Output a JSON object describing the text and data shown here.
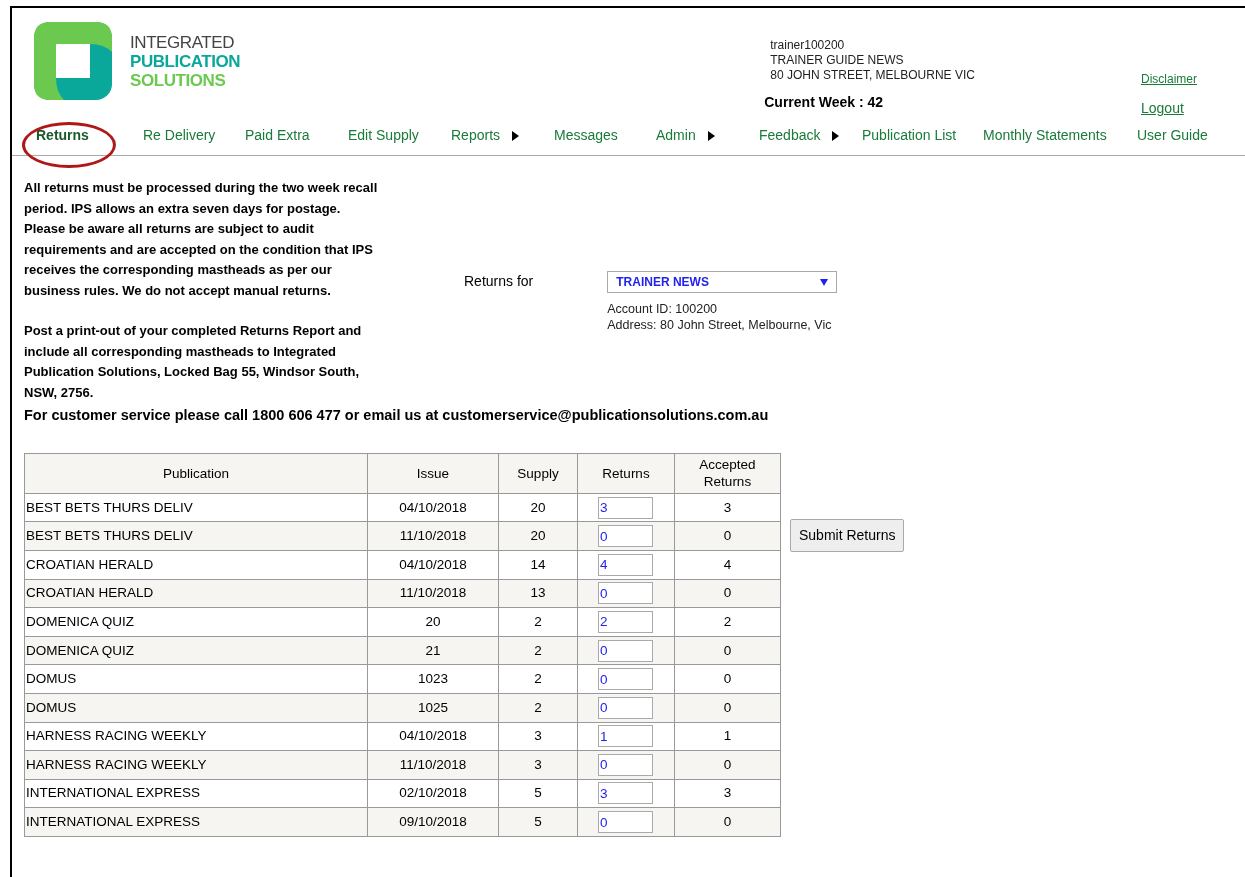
{
  "logo": {
    "lines": [
      "INTEGRATED",
      "PUBLICATION",
      "SOLUTIONS"
    ]
  },
  "account": {
    "username": "trainer100200",
    "name": "TRAINER GUIDE NEWS",
    "address": "80 JOHN STREET, MELBOURNE VIC",
    "current_week": "Current Week : 42"
  },
  "links": [
    "Disclaimer",
    "Logout"
  ],
  "nav": [
    {
      "label": "Returns",
      "selected": true,
      "circled": true,
      "has_submenu": false
    },
    {
      "label": "Re Delivery",
      "selected": false,
      "circled": false,
      "has_submenu": false
    },
    {
      "label": "Paid Extra",
      "selected": false,
      "circled": false,
      "has_submenu": false
    },
    {
      "label": "Edit Supply",
      "selected": false,
      "circled": false,
      "has_submenu": false
    },
    {
      "label": "Reports",
      "selected": false,
      "circled": false,
      "has_submenu": true
    },
    {
      "label": "Messages",
      "selected": false,
      "circled": false,
      "has_submenu": false
    },
    {
      "label": "Admin",
      "selected": false,
      "circled": false,
      "has_submenu": true
    },
    {
      "label": "Feedback",
      "selected": false,
      "circled": false,
      "has_submenu": true
    },
    {
      "label": "Publication List",
      "selected": false,
      "circled": false,
      "has_submenu": false
    },
    {
      "label": "Monthly Statements",
      "selected": false,
      "circled": false,
      "has_submenu": false
    },
    {
      "label": "User Guide",
      "selected": false,
      "circled": false,
      "has_submenu": false
    }
  ],
  "instructions": [
    "All returns must be processed during the two week recall period. IPS allows an extra seven days for postage. Please be aware all returns are subject to audit requirements and are accepted on the condition that IPS receives the corresponding mastheads as per our business rules. We do not accept manual returns.",
    "Post a print-out of your completed Returns Report and include all corresponding mastheads to Integrated Publication Solutions, Locked Bag 55, Windsor South, NSW, 2756."
  ],
  "returns_for": {
    "label": "Returns for",
    "value": "TRAINER NEWS",
    "account_id": "Account ID: 100200",
    "address": "Address: 80 John Street, Melbourne, Vic"
  },
  "customer_service": "For customer service please call 1800 606 477 or email us at customerservice@publicationsolutions.com.au",
  "table": {
    "columns": [
      "Publication",
      "Issue",
      "Supply",
      "Returns",
      "Accepted Returns"
    ],
    "rows": [
      [
        "BEST BETS THURS DELIV",
        "04/10/2018",
        "20",
        "3",
        "3"
      ],
      [
        "BEST BETS THURS DELIV",
        "11/10/2018",
        "20",
        "0",
        "0"
      ],
      [
        "CROATIAN HERALD",
        "04/10/2018",
        "14",
        "4",
        "4"
      ],
      [
        "CROATIAN HERALD",
        "11/10/2018",
        "13",
        "0",
        "0"
      ],
      [
        "DOMENICA QUIZ",
        "20",
        "2",
        "2",
        "2"
      ],
      [
        "DOMENICA QUIZ",
        "21",
        "2",
        "0",
        "0"
      ],
      [
        "DOMUS",
        "1023",
        "2",
        "0",
        "0"
      ],
      [
        "DOMUS",
        "1025",
        "2",
        "0",
        "0"
      ],
      [
        "HARNESS RACING WEEKLY",
        "04/10/2018",
        "3",
        "1",
        "1"
      ],
      [
        "HARNESS RACING WEEKLY",
        "11/10/2018",
        "3",
        "0",
        "0"
      ],
      [
        "INTERNATIONAL EXPRESS",
        "02/10/2018",
        "5",
        "3",
        "3"
      ],
      [
        "INTERNATIONAL EXPRESS",
        "09/10/2018",
        "5",
        "0",
        "0"
      ]
    ]
  },
  "submit_button": "Submit Returns"
}
